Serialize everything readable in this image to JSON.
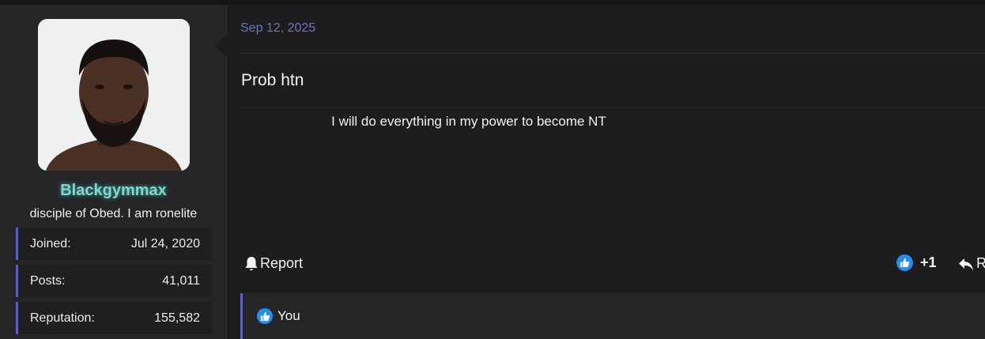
{
  "user": {
    "username": "Blackgymmax",
    "title": "disciple of Obed. I am ronelite",
    "stats": [
      {
        "label": "Joined:",
        "value": "Jul 24, 2020"
      },
      {
        "label": "Posts:",
        "value": "41,011"
      },
      {
        "label": "Reputation:",
        "value": "155,582"
      }
    ]
  },
  "post": {
    "date": "Sep 12, 2025",
    "title": "Prob htn",
    "body": "I will do everything in my power to become NT"
  },
  "actions": {
    "report_label": "Report",
    "like_count": "+1",
    "reply_label": "R"
  },
  "reactions": {
    "summary": "You"
  },
  "colors": {
    "accent": "#5a63b8",
    "date": "#6c72c8",
    "username": "#7fd7d2",
    "like": "#2a8ee8"
  }
}
